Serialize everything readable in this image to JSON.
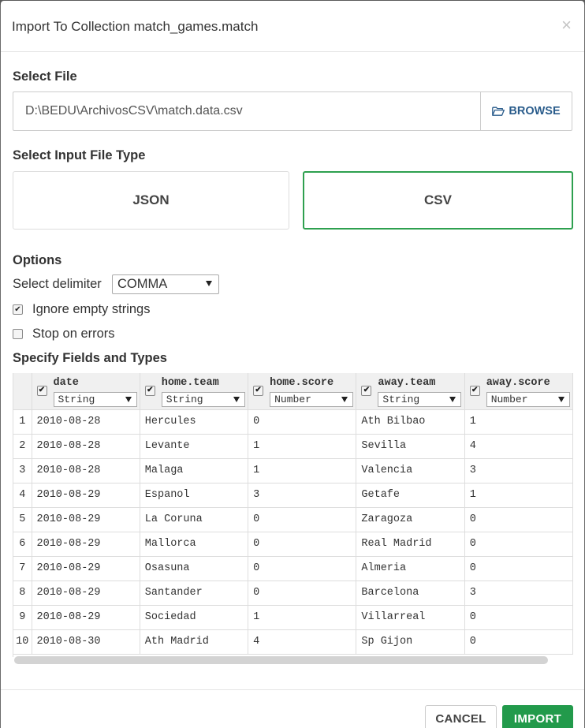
{
  "dialog": {
    "title": "Import To Collection match_games.match",
    "close_glyph": "×"
  },
  "file": {
    "section_label": "Select File",
    "path": "D:\\BEDU\\ArchivosCSV\\match.data.csv",
    "browse_label": "BROWSE"
  },
  "file_type": {
    "section_label": "Select Input File Type",
    "options": [
      "JSON",
      "CSV"
    ],
    "selected": "CSV"
  },
  "options": {
    "section_label": "Options",
    "delimiter_label": "Select delimiter",
    "delimiter_value": "COMMA",
    "ignore_empty_label": "Ignore empty strings",
    "ignore_empty_checked": true,
    "stop_on_errors_label": "Stop on errors",
    "stop_on_errors_checked": false
  },
  "fields": {
    "section_label": "Specify Fields and Types",
    "columns": [
      {
        "name": "date",
        "type": "String",
        "checked": true
      },
      {
        "name": "home.team",
        "type": "String",
        "checked": true
      },
      {
        "name": "home.score",
        "type": "Number",
        "checked": true
      },
      {
        "name": "away.team",
        "type": "String",
        "checked": true
      },
      {
        "name": "away.score",
        "type": "Number",
        "checked": true
      }
    ],
    "rows": [
      [
        "1",
        "2010-08-28",
        "Hercules",
        "0",
        "Ath Bilbao",
        "1"
      ],
      [
        "2",
        "2010-08-28",
        "Levante",
        "1",
        "Sevilla",
        "4"
      ],
      [
        "3",
        "2010-08-28",
        "Malaga",
        "1",
        "Valencia",
        "3"
      ],
      [
        "4",
        "2010-08-29",
        "Espanol",
        "3",
        "Getafe",
        "1"
      ],
      [
        "5",
        "2010-08-29",
        "La Coruna",
        "0",
        "Zaragoza",
        "0"
      ],
      [
        "6",
        "2010-08-29",
        "Mallorca",
        "0",
        "Real Madrid",
        "0"
      ],
      [
        "7",
        "2010-08-29",
        "Osasuna",
        "0",
        "Almeria",
        "0"
      ],
      [
        "8",
        "2010-08-29",
        "Santander",
        "0",
        "Barcelona",
        "3"
      ],
      [
        "9",
        "2010-08-29",
        "Sociedad",
        "1",
        "Villarreal",
        "0"
      ],
      [
        "10",
        "2010-08-30",
        "Ath Madrid",
        "4",
        "Sp Gijon",
        "0"
      ]
    ]
  },
  "footer": {
    "cancel_label": "CANCEL",
    "import_label": "IMPORT"
  },
  "colors": {
    "accent_green": "#2ea04f",
    "import_green": "#229a4b",
    "browse_blue": "#2b5d8c"
  },
  "icons": {
    "browse": "folder-open-icon",
    "close": "close-icon",
    "dropdown": "caret-down-icon",
    "checkbox": "checkbox-icon"
  }
}
